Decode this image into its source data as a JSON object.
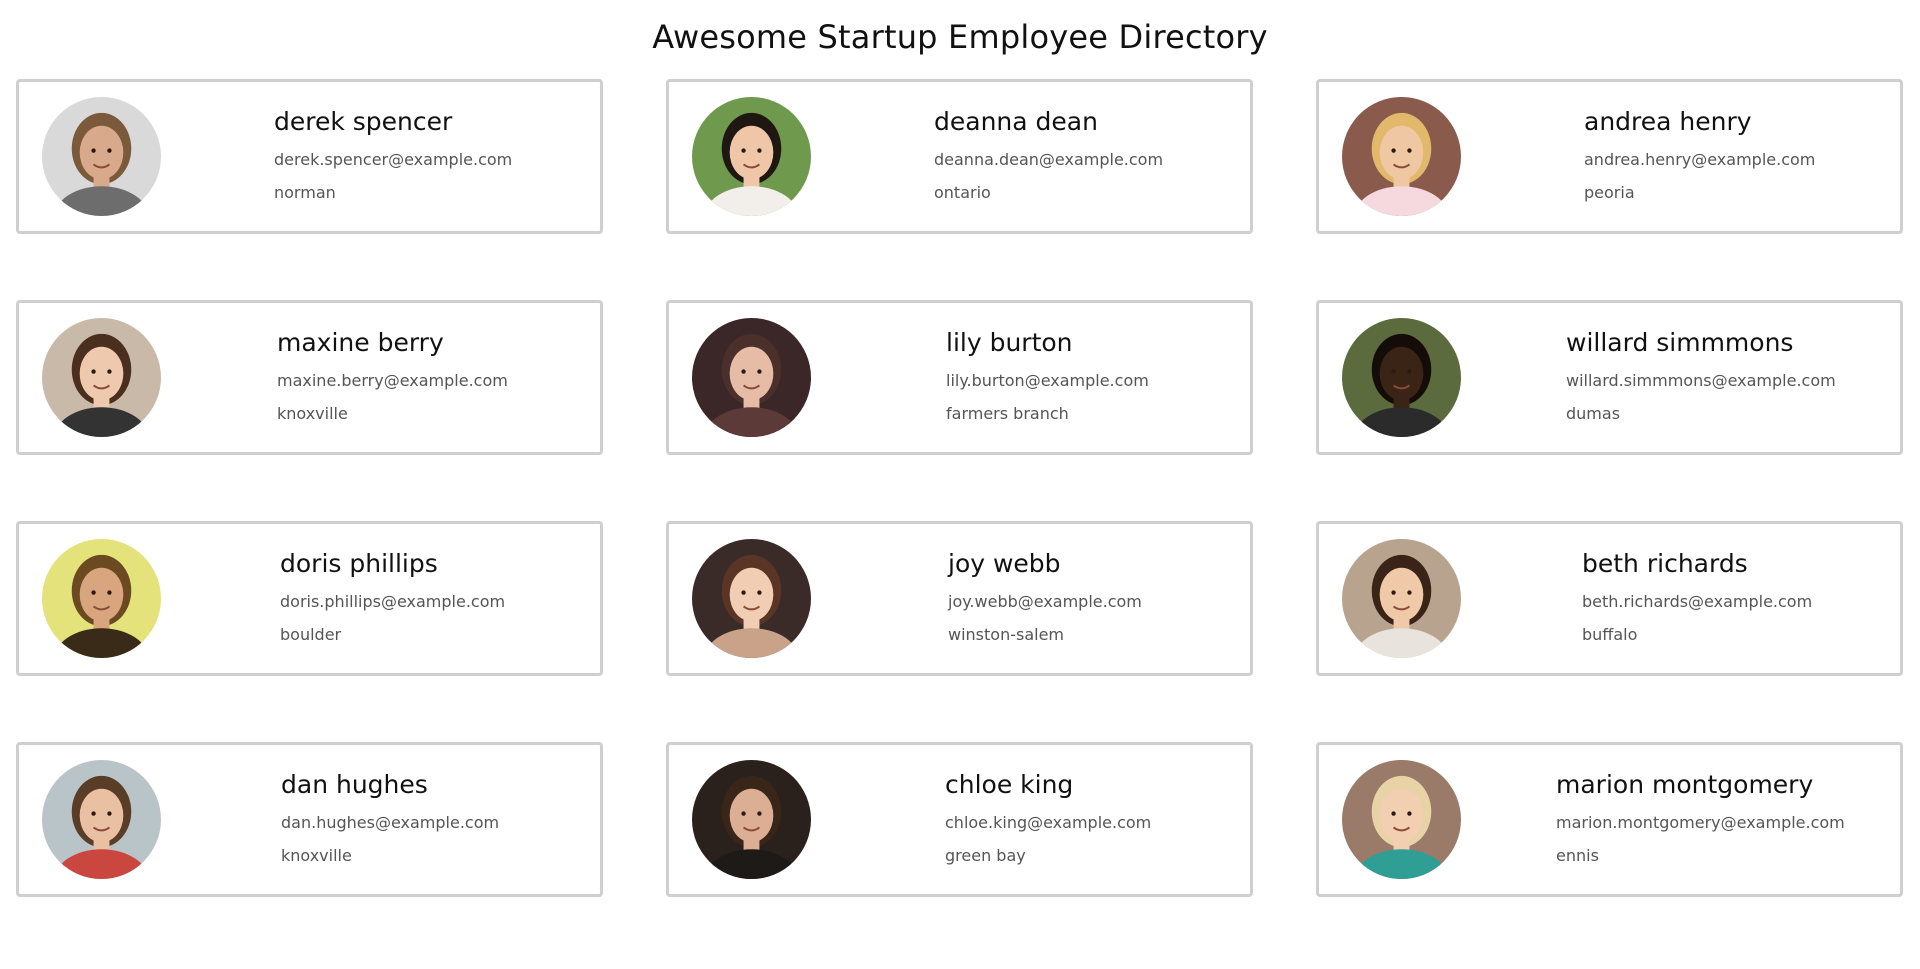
{
  "header": {
    "title": "Awesome Startup Employee Directory"
  },
  "employees": [
    {
      "name": "derek spencer",
      "email": "derek.spencer@example.com",
      "city": "norman",
      "bg": "#d9d9d9",
      "skin": "#d8a98a",
      "hair": "#7a5a3a",
      "shirt": "#6d6d6d"
    },
    {
      "name": "deanna dean",
      "email": "deanna.dean@example.com",
      "city": "ontario",
      "bg": "#6f9a4e",
      "skin": "#efc7a8",
      "hair": "#1f1712",
      "shirt": "#f2eeea"
    },
    {
      "name": "andrea henry",
      "email": "andrea.henry@example.com",
      "city": "peoria",
      "bg": "#8a5a4c",
      "skin": "#f0c7a3",
      "hair": "#e2b86b",
      "shirt": "#f6d9df"
    },
    {
      "name": "maxine berry",
      "email": "maxine.berry@example.com",
      "city": "knoxville",
      "bg": "#c9b9a8",
      "skin": "#efc9ad",
      "hair": "#4a2e1e",
      "shirt": "#333333"
    },
    {
      "name": "lily burton",
      "email": "lily.burton@example.com",
      "city": "farmers branch",
      "bg": "#3b2628",
      "skin": "#e6bca6",
      "hair": "#4a2f2b",
      "shirt": "#5b3a38"
    },
    {
      "name": "willard simmmons",
      "email": "willard.simmmons@example.com",
      "city": "dumas",
      "bg": "#5c6b3e",
      "skin": "#3a2416",
      "hair": "#140c08",
      "shirt": "#2b2b2b"
    },
    {
      "name": "doris phillips",
      "email": "doris.phillips@example.com",
      "city": "boulder",
      "bg": "#e4e27a",
      "skin": "#d9a57e",
      "hair": "#6b4a22",
      "shirt": "#3a2a18"
    },
    {
      "name": "joy webb",
      "email": "joy.webb@example.com",
      "city": "winston-salem",
      "bg": "#3a2a28",
      "skin": "#f1cdb4",
      "hair": "#5a3526",
      "shirt": "#caa28a"
    },
    {
      "name": "beth richards",
      "email": "beth.richards@example.com",
      "city": "buffalo",
      "bg": "#b8a48e",
      "skin": "#f0caa8",
      "hair": "#3a2418",
      "shirt": "#e8e3dc"
    },
    {
      "name": "dan hughes",
      "email": "dan.hughes@example.com",
      "city": "knoxville",
      "bg": "#b9c4c9",
      "skin": "#e9c0a2",
      "hair": "#5a3d27",
      "shirt": "#c9473f"
    },
    {
      "name": "chloe king",
      "email": "chloe.king@example.com",
      "city": "green bay",
      "bg": "#2b211c",
      "skin": "#dcae93",
      "hair": "#3a2519",
      "shirt": "#1d1a18"
    },
    {
      "name": "marion montgomery",
      "email": "marion.montgomery@example.com",
      "city": "ennis",
      "bg": "#9a7a68",
      "skin": "#f2cfb0",
      "hair": "#e7d3a6",
      "shirt": "#2f9f95"
    }
  ]
}
